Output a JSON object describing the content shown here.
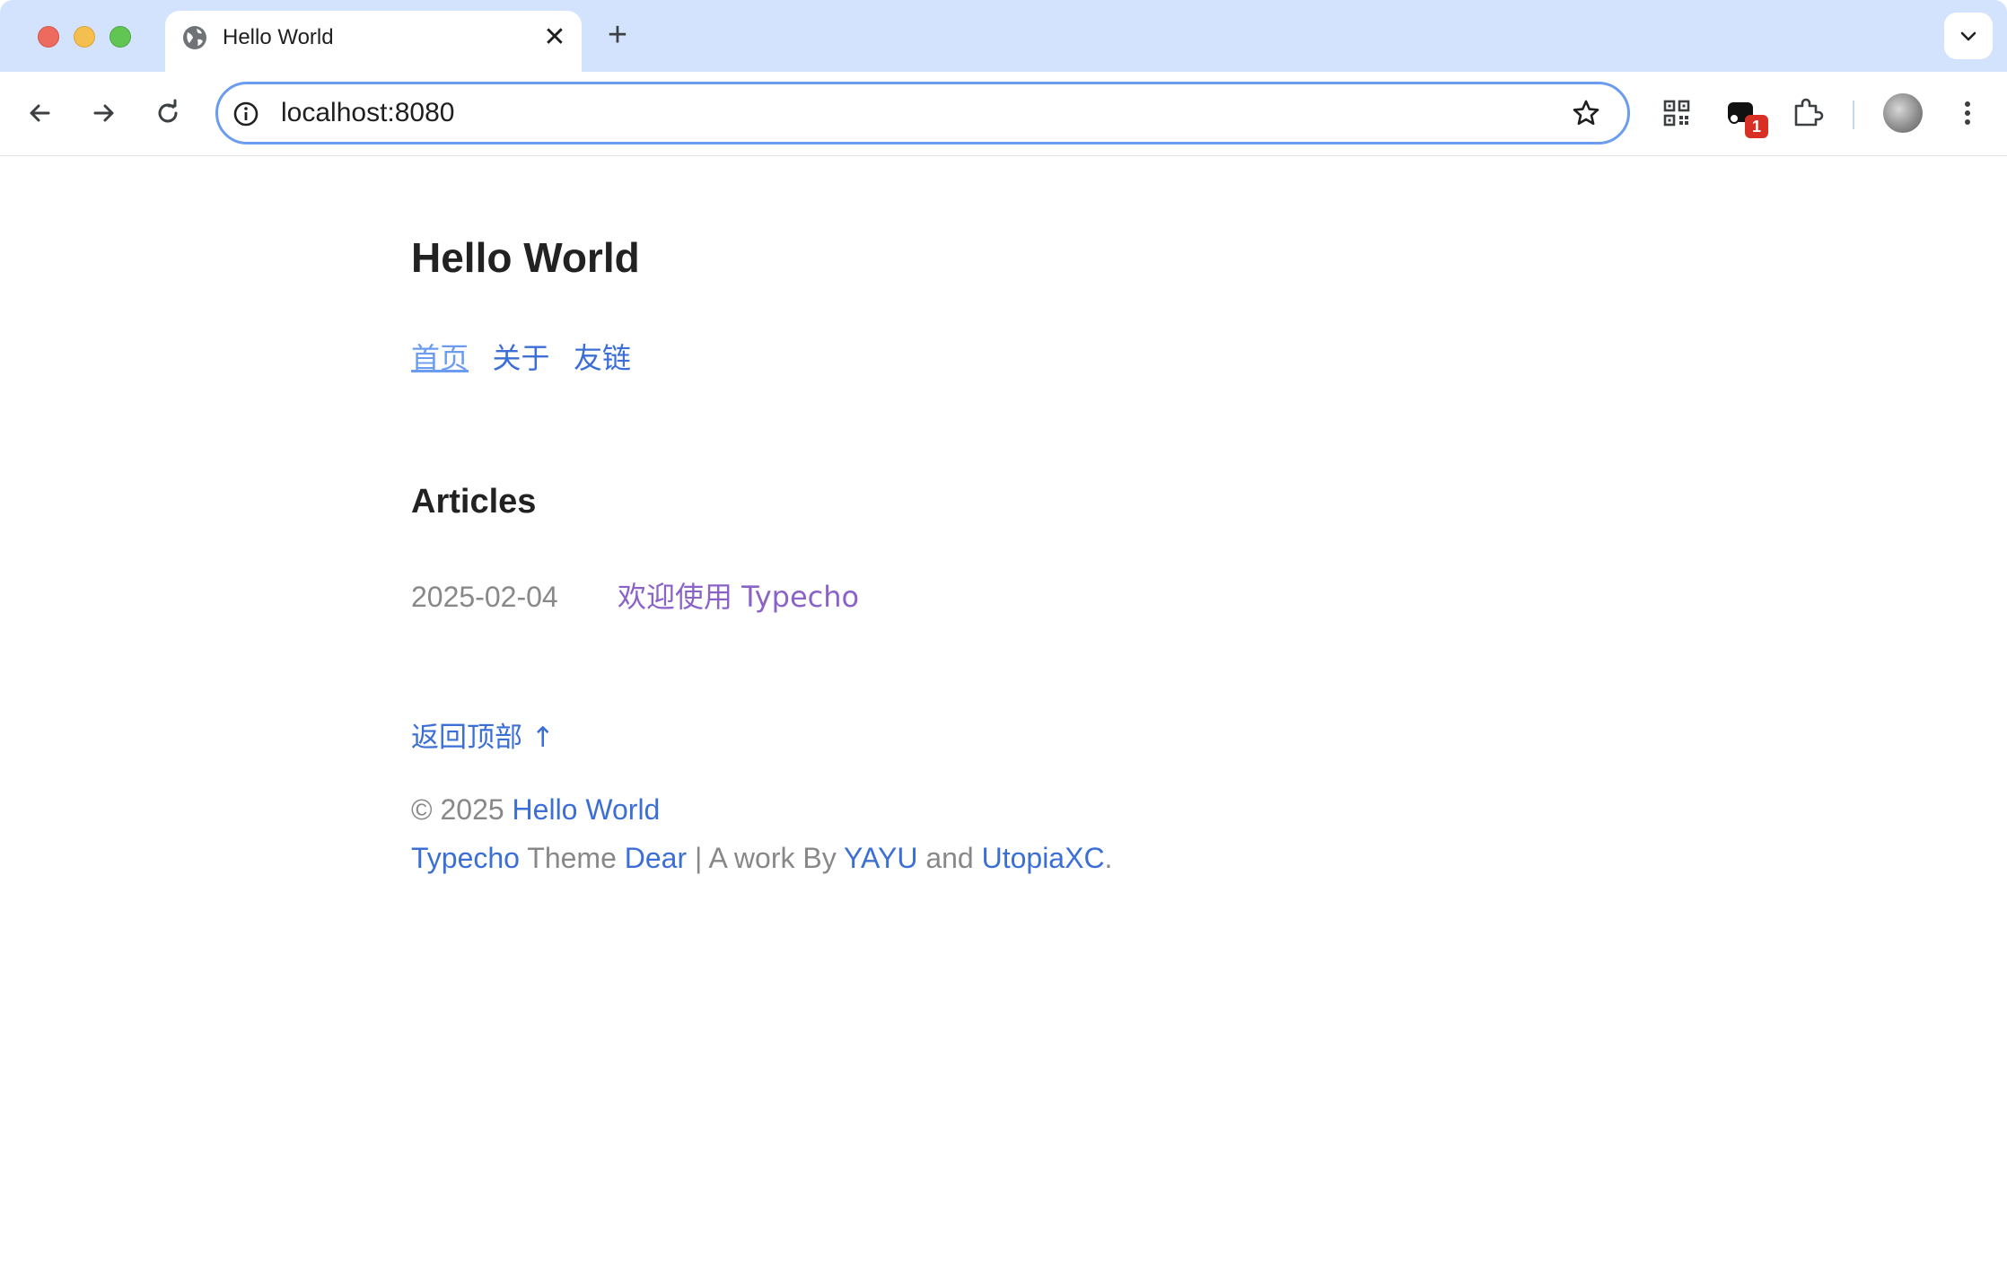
{
  "browser": {
    "tab_title": "Hello World",
    "tab_close": "✕",
    "new_tab": "+",
    "url": "localhost:8080",
    "extension_badge": "1",
    "icons": [
      "globe-icon",
      "close-icon",
      "plus-icon",
      "chevron-down-icon",
      "back-icon",
      "forward-icon",
      "reload-icon",
      "info-icon",
      "star-icon",
      "qr-code-icon",
      "extension-icon",
      "puzzle-icon",
      "avatar",
      "more-vert-icon"
    ]
  },
  "page": {
    "site_title": "Hello World",
    "nav": [
      "首页",
      "关于",
      "友链"
    ],
    "section_title": "Articles",
    "article": {
      "date": "2025-02-04",
      "title": "欢迎使用 Typecho"
    },
    "back_to_top": "返回顶部 ↑",
    "copyright_prefix": "© 2025",
    "copyright_link": "Hello World",
    "credits": {
      "typecho": "Typecho",
      "theme_text": "Theme",
      "dear": "Dear",
      "by_text": "| A work By",
      "yayu": "YAYU",
      "and_text": "and",
      "utopia": "UtopiaXC",
      "period": "."
    }
  },
  "colors": {
    "link": "#3b6fd6",
    "visited": "#8a62c8",
    "muted": "#888888",
    "tab_strip": "#d3e3fd"
  }
}
